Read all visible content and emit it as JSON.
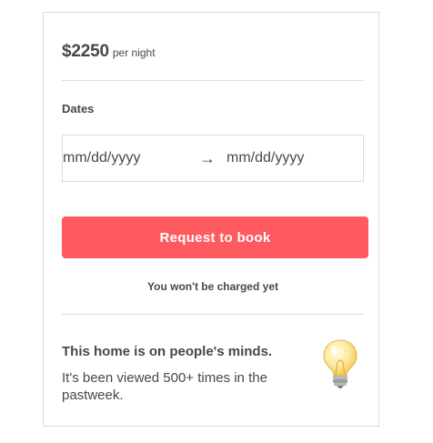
{
  "booking": {
    "price": "$2250",
    "per_night": "per night",
    "dates_label": "Dates",
    "check_in": {
      "placeholder": "mm/dd/yyyy",
      "value": ""
    },
    "check_out": {
      "placeholder": "mm/dd/yyyy",
      "value": ""
    },
    "arrow": "→",
    "book_button": "Request to book",
    "charged_note": "You won't be charged yet"
  },
  "popularity": {
    "title": "This home is on people's minds.",
    "body": "It's been viewed 500+ times in the pastweek.",
    "icon": "lightbulb-icon"
  },
  "colors": {
    "accent": "#ff5a5f",
    "text": "#484848",
    "border": "#dcdcdc"
  }
}
